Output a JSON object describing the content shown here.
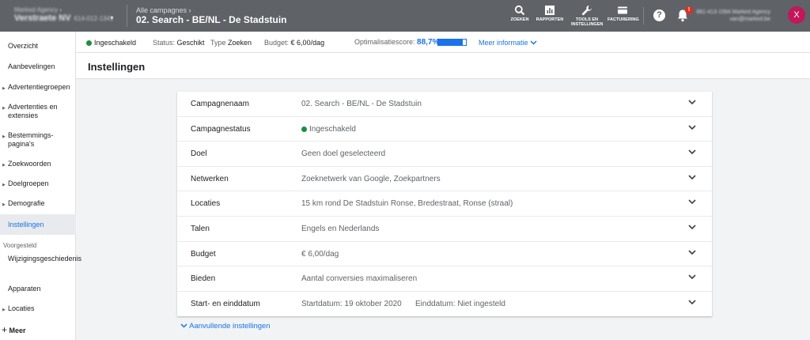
{
  "topbar": {
    "account_line": "Marked Agency",
    "account_name": "Verstraete NV",
    "account_id": "614-012-1341",
    "breadcrumb": "Alle campagnes",
    "campaign_title": "02. Search - BE/NL - De Stadstuin",
    "tools": [
      {
        "label": "ZOEKEN",
        "icon": "search-icon"
      },
      {
        "label": "RAPPORTEN",
        "icon": "reports-icon"
      },
      {
        "label": "TOOLS EN INSTELLINGEN",
        "icon": "wrench-icon"
      },
      {
        "label": "FACTURERING",
        "icon": "billing-card-icon"
      }
    ],
    "help_glyph": "?",
    "notification_count": "!",
    "user_line1": "881-413-1584 Marked Agency",
    "user_line2": "van@marked.be",
    "avatar_letter": "X",
    "avatar_color": "#c2185b"
  },
  "sidebar": {
    "items": [
      {
        "label": "Overzicht",
        "arrow": false
      },
      {
        "label": "Aanbevelingen",
        "arrow": false
      },
      {
        "label": "Advertentiegroepen",
        "arrow": true
      },
      {
        "label": "Advertenties en extensies",
        "arrow": true
      },
      {
        "label": "Bestemmings-pagina's",
        "arrow": true
      },
      {
        "label": "Zoekwoorden",
        "arrow": true
      },
      {
        "label": "Doelgroepen",
        "arrow": true
      },
      {
        "label": "Demografie",
        "arrow": true
      },
      {
        "label": "Instellingen",
        "arrow": false,
        "active": true
      }
    ],
    "section_label": "Voorgesteld",
    "suggested": [
      {
        "label": "Wijzigingsgeschiedenis",
        "arrow": false
      },
      {
        "label": "Apparaten",
        "arrow": false
      },
      {
        "label": "Locaties",
        "arrow": true
      }
    ],
    "more_label": "Meer"
  },
  "status": {
    "state": "Ingeschakeld",
    "status_key": "Status:",
    "status_val": "Geschikt",
    "type_key": "Type",
    "type_val": "Zoeken",
    "budget_key": "Budget:",
    "budget_val": "€ 6,00/dag",
    "score_key": "Optimalisatiescore:",
    "score_val": "88,7%",
    "score_fraction": 0.887,
    "more_info": "Meer informatie"
  },
  "page": {
    "title": "Instellingen"
  },
  "settings": [
    {
      "key": "Campagnenaam",
      "value": "02. Search - BE/NL - De Stadstuin"
    },
    {
      "key": "Campagnestatus",
      "value": "Ingeschakeld",
      "status_dot": true
    },
    {
      "key": "Doel",
      "value": "Geen doel geselecteerd"
    },
    {
      "key": "Netwerken",
      "value": "Zoeknetwerk van Google, Zoekpartners"
    },
    {
      "key": "Locaties",
      "value": "15 km rond De Stadstuin Ronse, Bredestraat, Ronse (straal)"
    },
    {
      "key": "Talen",
      "value": "Engels en Nederlands"
    },
    {
      "key": "Budget",
      "value": "€ 6,00/dag"
    },
    {
      "key": "Bieden",
      "value": "Aantal conversies maximaliseren"
    },
    {
      "key": "Start- en einddatum",
      "value": "Startdatum: 19 oktober 2020",
      "value2": "Einddatum: Niet ingesteld"
    }
  ],
  "additional_settings": "Aanvullende instellingen",
  "colors": {
    "topbar": "#5f6368",
    "accent": "#1a73e8",
    "enabled": "#1e8e3e"
  }
}
